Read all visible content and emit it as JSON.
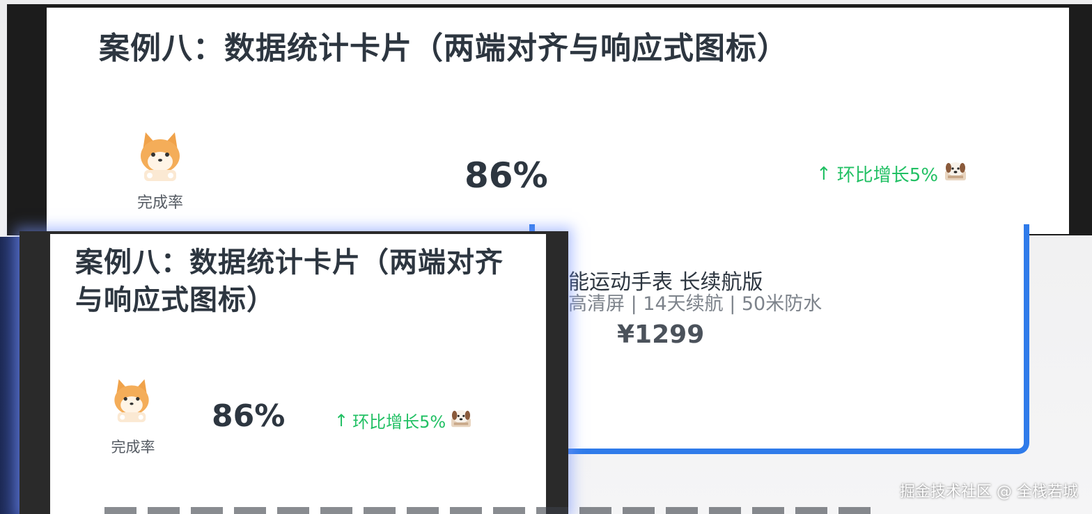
{
  "top_card": {
    "title": "案例八：数据统计卡片（两端对齐与响应式图标）",
    "icon": "shiba-dog-icon",
    "label": "完成率",
    "value": "86%",
    "trend_arrow": "↑",
    "trend_text": "环比增长5%",
    "trend_icon": "dog-face-icon",
    "trend_color": "#22c064"
  },
  "product_card": {
    "title": "能运动手表 长续航版",
    "desc": "高清屏 | 14天续航 | 50米防水",
    "price": "¥1299",
    "border_color": "#2f7bea"
  },
  "small_card": {
    "title": "案例八：数据统计卡片（两端对齐与响应式图标）",
    "icon": "shiba-dog-icon",
    "label": "完成率",
    "value": "86%",
    "trend_arrow": "↑",
    "trend_text": "环比增长5%",
    "trend_icon": "dog-face-icon"
  },
  "watermark": "掘金技术社区 @ 全栈若城"
}
